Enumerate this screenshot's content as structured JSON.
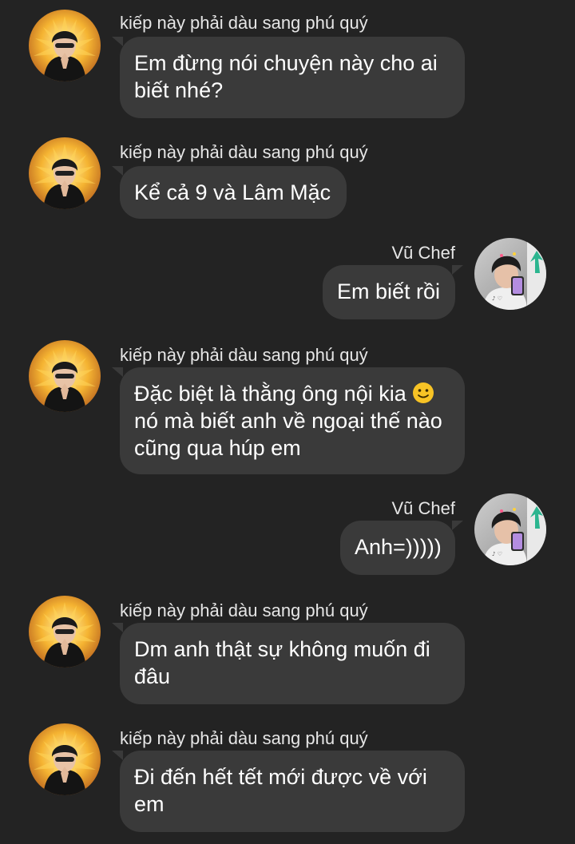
{
  "conversation": {
    "sender_other": "kiếp này phải dàu sang phú quý",
    "sender_self": "Vũ Chef",
    "messages": [
      {
        "from": "other",
        "lines": [
          "Em đừng nói chuyện này cho ai",
          "biết nhé?"
        ]
      },
      {
        "from": "other",
        "lines": [
          "Kể cả 9 và Lâm Mặc"
        ]
      },
      {
        "from": "self",
        "lines": [
          "Em biết rồi"
        ]
      },
      {
        "from": "other",
        "lines": [
          "Đặc biệt là thằng ông nội kia",
          "nó mà biết anh về ngoại thế nào",
          "cũng qua húp em"
        ],
        "emoji": "slightly-smiling-face-emoji"
      },
      {
        "from": "self",
        "lines": [
          "Anh=)))))"
        ]
      },
      {
        "from": "other",
        "lines": [
          "Dm anh thật sự không muốn đi",
          "đâu"
        ]
      },
      {
        "from": "other",
        "lines": [
          "Đi đến hết tết mới được về với",
          "em"
        ]
      }
    ]
  },
  "colors": {
    "background": "#232323",
    "bubble": "#3a3a3a",
    "text": "#ffffff",
    "sender_name": "#e6e6e6",
    "emoji": "#f7c325"
  },
  "icons": {
    "other_avatar": "profile-photo-person-black-beanie-yellow-background",
    "self_avatar": "profile-photo-young-man-taking-mirror-selfie"
  }
}
